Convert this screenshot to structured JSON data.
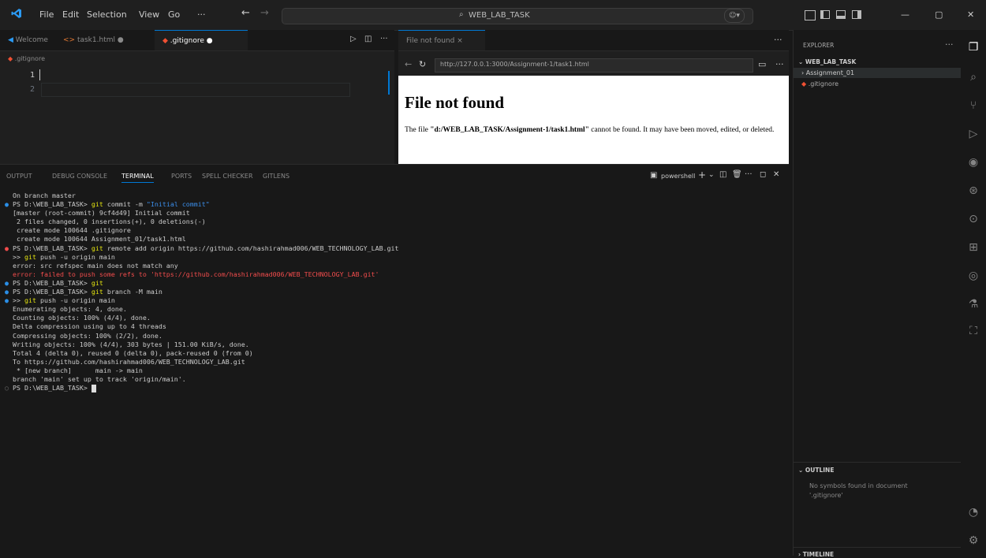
{
  "titlebar": {
    "menu": [
      "File",
      "Edit",
      "Selection",
      "View",
      "Go",
      "···"
    ],
    "search_text": "WEB_LAB_TASK"
  },
  "editor": {
    "tabs": [
      "Welcome",
      "task1.html ●",
      ".gitignore ●"
    ],
    "breadcrumb": ".gitignore",
    "line_numbers": [
      "1",
      "2"
    ]
  },
  "preview": {
    "tab_label": "File not found",
    "url": "http://127.0.0.1:3000/Assignment-1/task1.html",
    "heading": "File not found",
    "message_prefix": "The file ",
    "message_path": "\"d:/WEB_LAB_TASK/Assignment-1/task1.html\"",
    "message_suffix": " cannot be found. It may have been moved, edited, or deleted."
  },
  "panel": {
    "tabs": [
      "OUTPUT",
      "DEBUG CONSOLE",
      "TERMINAL",
      "PORTS",
      "SPELL CHECKER",
      "GITLENS"
    ],
    "active_tab": "TERMINAL",
    "shell_label": "powershell"
  },
  "terminal": {
    "lines": [
      {
        "t": "On branch master",
        "c": "normal"
      },
      {
        "t": "PS D:\\WEB_LAB_TASK> git commit -m \"Initial commit\"",
        "c": "cmd"
      },
      {
        "t": "[master (root-commit) 9cf4d49] Initial commit",
        "c": "normal"
      },
      {
        "t": " 2 files changed, 0 insertions(+), 0 deletions(-)",
        "c": "normal"
      },
      {
        "t": " create mode 100644 .gitignore",
        "c": "normal"
      },
      {
        "t": " create mode 100644 Assignment_01/task1.html",
        "c": "normal"
      },
      {
        "t": "PS D:\\WEB_LAB_TASK> git remote add origin https://github.com/hashirahmad006/WEB_TECHNOLOGY_LAB.git",
        "c": "cmd-err"
      },
      {
        "t": ">> git push -u origin main",
        "c": "cont"
      },
      {
        "t": "error: src refspec main does not match any",
        "c": "normal"
      },
      {
        "t": "error: failed to push some refs to 'https://github.com/hashirahmad006/WEB_TECHNOLOGY_LAB.git'",
        "c": "err"
      },
      {
        "t": "PS D:\\WEB_LAB_TASK> git",
        "c": "cmd"
      },
      {
        "t": "PS D:\\WEB_LAB_TASK> git branch -M main",
        "c": "cmd"
      },
      {
        "t": ">> git push -u origin main",
        "c": "cont-dot"
      },
      {
        "t": "Enumerating objects: 4, done.",
        "c": "normal"
      },
      {
        "t": "Counting objects: 100% (4/4), done.",
        "c": "normal"
      },
      {
        "t": "Delta compression using up to 4 threads",
        "c": "normal"
      },
      {
        "t": "Compressing objects: 100% (2/2), done.",
        "c": "normal"
      },
      {
        "t": "Writing objects: 100% (4/4), 303 bytes | 151.00 KiB/s, done.",
        "c": "normal"
      },
      {
        "t": "Total 4 (delta 0), reused 0 (delta 0), pack-reused 0 (from 0)",
        "c": "normal"
      },
      {
        "t": "To https://github.com/hashirahmad006/WEB_TECHNOLOGY_LAB.git",
        "c": "normal"
      },
      {
        "t": " * [new branch]      main -> main",
        "c": "normal"
      },
      {
        "t": "branch 'main' set up to track 'origin/main'.",
        "c": "normal"
      },
      {
        "t": "PS D:\\WEB_LAB_TASK> ",
        "c": "prompt"
      }
    ]
  },
  "explorer": {
    "header": "EXPLORER",
    "root": "WEB_LAB_TASK",
    "items": [
      "Assignment_01",
      ".gitignore"
    ],
    "outline_header": "OUTLINE",
    "outline_msg": "No symbols found in document '.gitignore'",
    "timeline_header": "TIMELINE"
  },
  "colors": {
    "accent": "#0078d4",
    "error": "#f14c4c",
    "keyword": "#e5e510",
    "string": "#3b8eea"
  }
}
